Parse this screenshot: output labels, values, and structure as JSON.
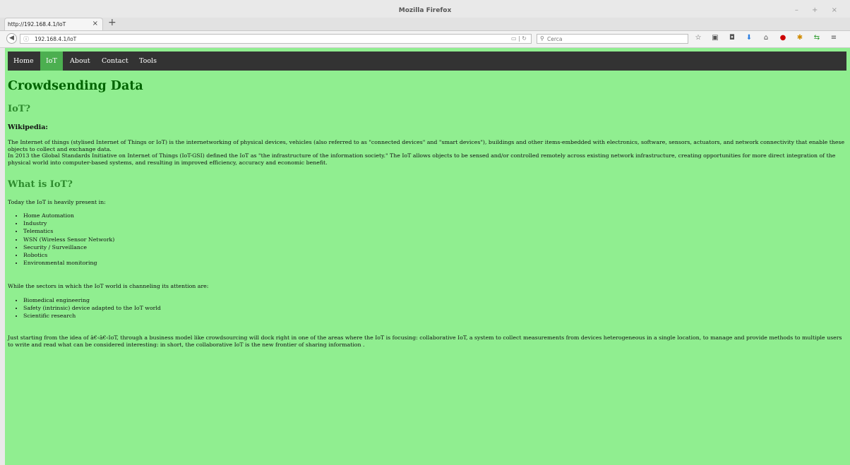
{
  "browser": {
    "window_title": "Mozilla Firefox",
    "window_controls": "– + ×",
    "tab_label": "http://192.168.4.1/IoT",
    "tab_close": "×",
    "new_tab": "+",
    "url_info_icon": "ⓘ",
    "url": "192.168.4.1/IoT",
    "url_icons": "▭ | ↻",
    "search_placeholder": "Cerca"
  },
  "site_nav": {
    "items": [
      {
        "label": "Home"
      },
      {
        "label": "IoT"
      },
      {
        "label": "About"
      },
      {
        "label": "Contact"
      },
      {
        "label": "Tools"
      }
    ],
    "active_index": 1,
    "active_color": "#4caf50",
    "bar_color": "#333333"
  },
  "page": {
    "background": "#90ee90",
    "title": "Crowdsending Data",
    "heading_iot": "IoT?",
    "wiki_heading": "Wikipedia:",
    "wiki_p1": "The Internet of things (stylised Internet of Things or IoT) is the internetworking of physical devices, vehicles (also referred to as \"connected devices\" and \"smart devices\"), buildings and other items-embedded with electronics, software, sensors, actuators, and network connectivity that enable these objects to collect and exchange data.",
    "wiki_p2": "In 2013 the Global Standards Initiative on Internet of Things (IoT-GSI) defined the IoT as \"the infrastructure of the information society.\" The IoT allows objects to be sensed and/or controlled remotely across existing network infrastructure, creating opportunities for more direct integration of the physical world into computer-based systems, and resulting in improved efficiency, accuracy and economic benefit.",
    "heading_what": "What is IoT?",
    "today_text": "Today the IoT is heavily present in:",
    "present_in": [
      "Home Automation",
      "Industry",
      "Telematics",
      "WSN (Wireless Sensor Network)",
      "Security / Surveillance",
      "Robotics",
      "Environmental monitoring"
    ],
    "while_text": "While the sectors in which the IoT world is channeling its attention are:",
    "sectors": [
      "Biomedical engineering",
      "Safety (intrinsic) device adapted to the IoT world",
      "Scientific research"
    ],
    "final_text": "Just starting from the idea of â€‹â€‹IoT, through a business model like crowdsourcing will dock right in one of the areas where the IoT is focusing: collaborative IoT, a system to collect measurements from devices heterogeneous in a single location, to manage and provide methods to multiple users to write and read what can be considered interesting: in short, the collaborative IoT is the new frontier of sharing information ."
  }
}
